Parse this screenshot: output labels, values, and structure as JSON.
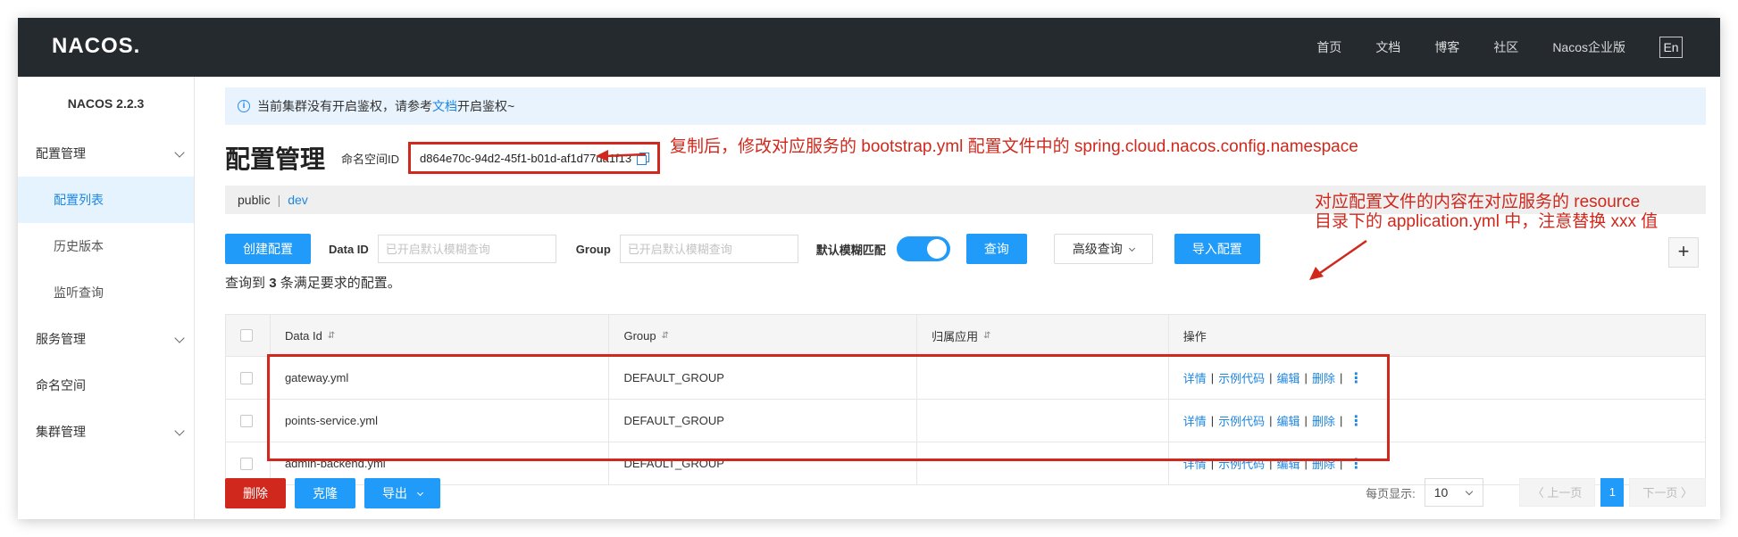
{
  "header": {
    "logo": "NACOS.",
    "nav": [
      "首页",
      "文档",
      "博客",
      "社区",
      "Nacos企业版"
    ],
    "lang": "En"
  },
  "sidebar": {
    "version": "NACOS 2.2.3",
    "config_group": "配置管理",
    "config_items": [
      "配置列表",
      "历史版本",
      "监听查询"
    ],
    "service_group": "服务管理",
    "namespace": "命名空间",
    "cluster_group": "集群管理"
  },
  "notice": {
    "text_before": "当前集群没有开启鉴权，请参考",
    "link": "文档",
    "text_after": "开启鉴权~"
  },
  "page": {
    "title": "配置管理",
    "ns_label": "命名空间ID",
    "ns_id": "d864e70c-94d2-45f1-b01d-af1d77da1f13",
    "ns_public": "public",
    "ns_sep": "|",
    "ns_dev": "dev"
  },
  "annotations": {
    "ns_note": "复制后，修改对应服务的 bootstrap.yml 配置文件中的 spring.cloud.nacos.config.namespace",
    "config_note_line1": "对应配置文件的内容在对应服务的 resource",
    "config_note_line2": "目录下的 application.yml 中，注意替换 xxx 值"
  },
  "search": {
    "create_btn": "创建配置",
    "dataid_label": "Data ID",
    "dataid_placeholder": "已开启默认模糊查询",
    "group_label": "Group",
    "group_placeholder": "已开启默认模糊查询",
    "fuzzy_label": "默认模糊匹配",
    "query_btn": "查询",
    "advanced_btn": "高级查询",
    "import_btn": "导入配置",
    "plus": "+"
  },
  "result": {
    "prefix": "查询到",
    "count": "3",
    "suffix": "条满足要求的配置。"
  },
  "table": {
    "headers": [
      "Data Id",
      "Group",
      "归属应用",
      "操作"
    ],
    "sort_glyph": "⇵",
    "rows": [
      {
        "data_id": "gateway.yml",
        "group": "DEFAULT_GROUP",
        "app": ""
      },
      {
        "data_id": "points-service.yml",
        "group": "DEFAULT_GROUP",
        "app": ""
      },
      {
        "data_id": "admin-backend.yml",
        "group": "DEFAULT_GROUP",
        "app": ""
      }
    ],
    "ops": {
      "detail": "详情",
      "sample": "示例代码",
      "edit": "编辑",
      "delete": "删除",
      "sep": "|",
      "more": "⋮"
    }
  },
  "bottom": {
    "delete_btn": "删除",
    "clone_btn": "克隆",
    "export_btn": "导出",
    "page_size_label": "每页显示:",
    "page_size": "10",
    "prev": "〈 上一页",
    "current_page": "1",
    "next": "下一页 〉"
  }
}
